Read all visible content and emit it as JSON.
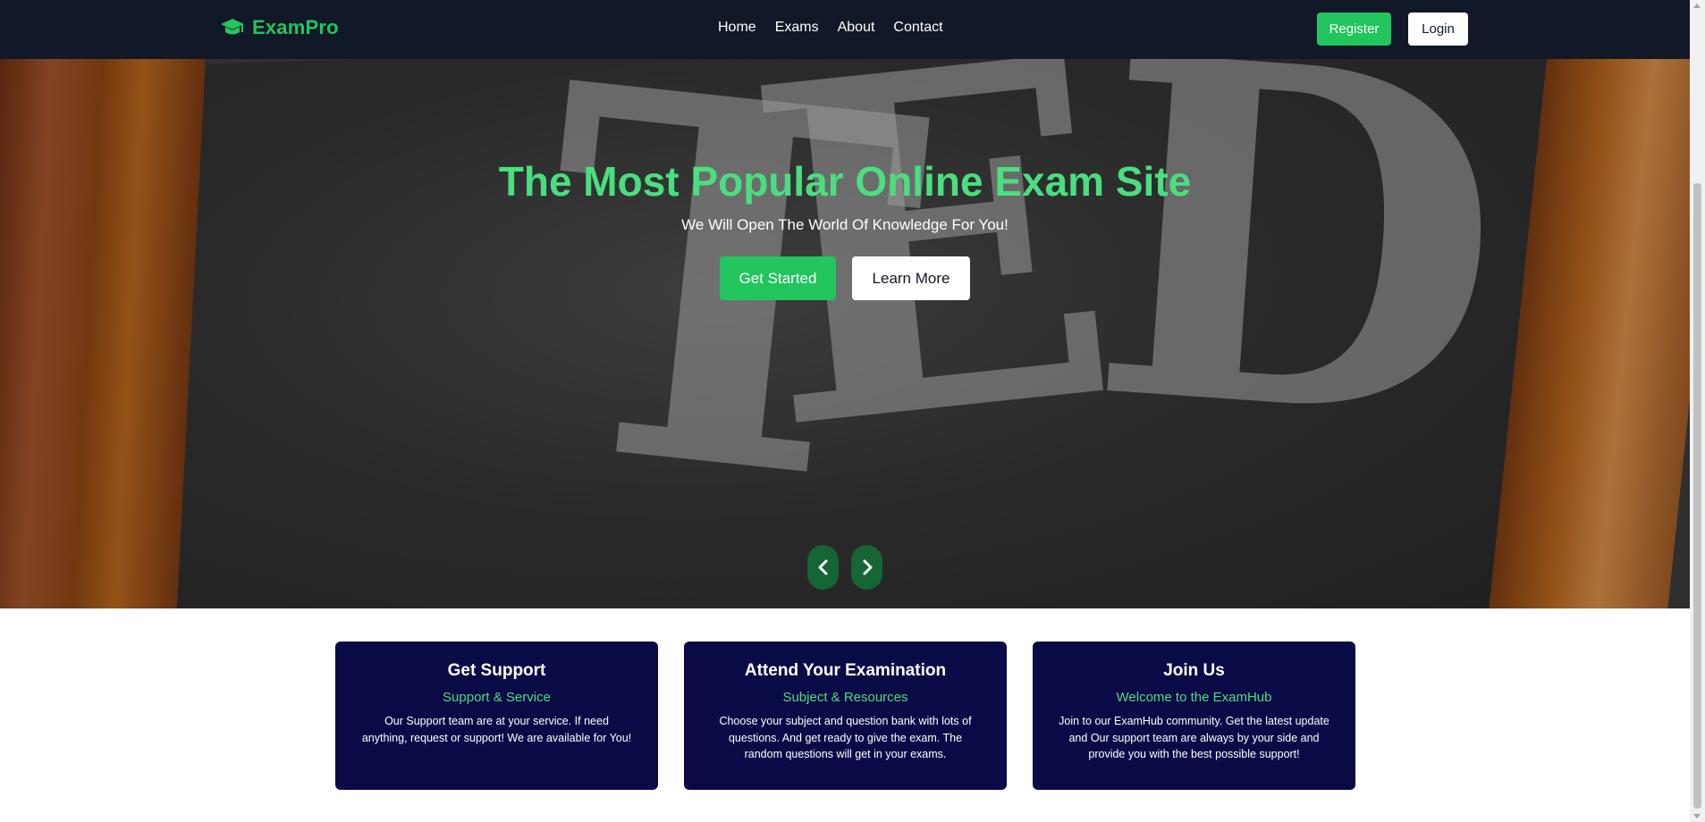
{
  "colors": {
    "nav_bg": "#111827",
    "accent_green": "#22c55e",
    "hero_title_green": "#4ade80",
    "card_bg": "#0a0a46",
    "carousel_btn": "#166534"
  },
  "navbar": {
    "brand_icon": "graduation-cap-icon",
    "brand_name": "ExamPro",
    "links": [
      "Home",
      "Exams",
      "About",
      "Contact"
    ],
    "register_label": "Register",
    "login_label": "Login"
  },
  "hero": {
    "title": "The Most Popular Online Exam Site",
    "subtitle": "We Will Open The World Of Knowledge For You!",
    "get_started_label": "Get Started",
    "learn_more_label": "Learn More",
    "prev_icon": "chevron-left-icon",
    "next_icon": "chevron-right-icon"
  },
  "cards": [
    {
      "title": "Get Support",
      "subtitle": "Support & Service",
      "text": "Our Support team are at your service. If need anything, request or support! We are available for You!"
    },
    {
      "title": "Attend Your Examination",
      "subtitle": "Subject & Resources",
      "text": "Choose your subject and question bank with lots of questions. And get ready to give the exam. The random questions will get in your exams."
    },
    {
      "title": "Join Us",
      "subtitle": "Welcome to the ExamHub",
      "text": "Join to our ExamHub community. Get the latest update and Our support team are always by your side and provide you with the best possible support!"
    }
  ]
}
